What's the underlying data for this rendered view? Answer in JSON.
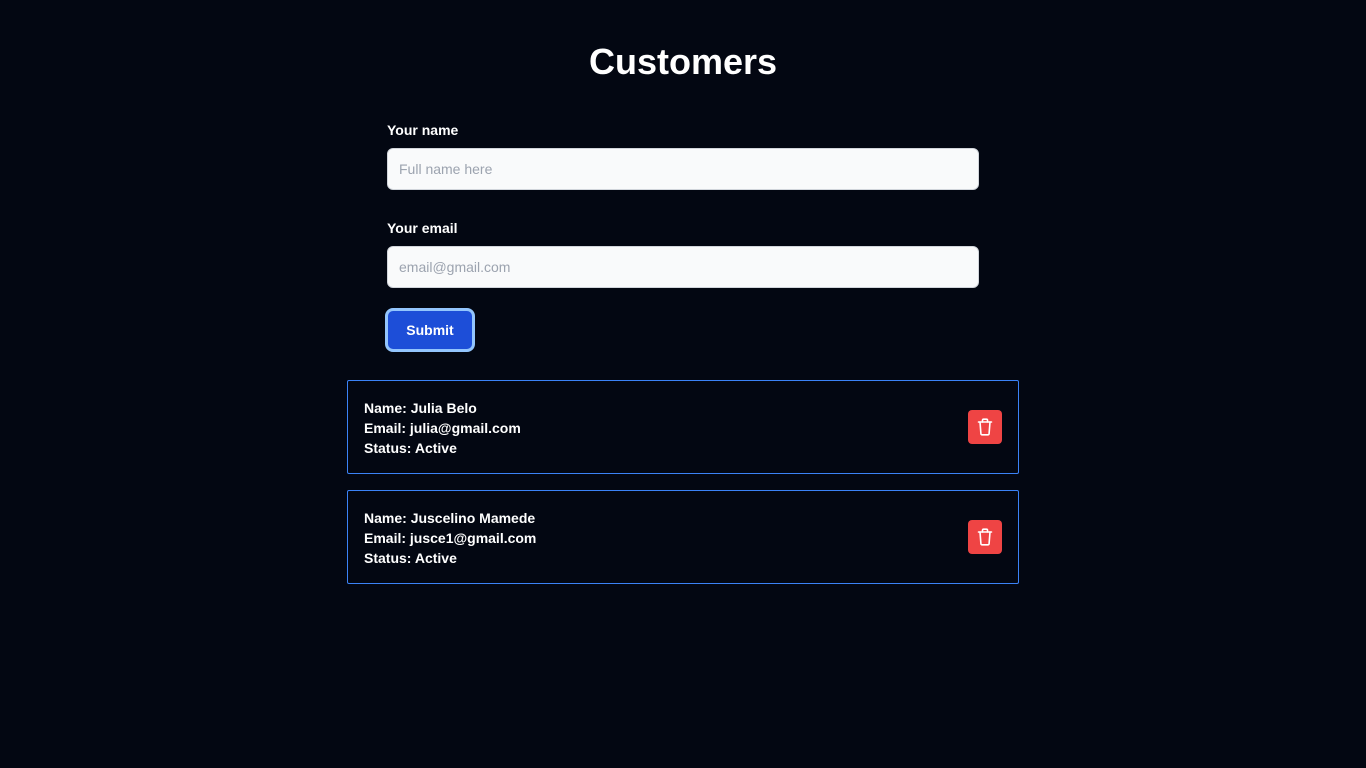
{
  "page": {
    "title": "Customers"
  },
  "form": {
    "name_label": "Your name",
    "name_placeholder": "Full name here",
    "name_value": "",
    "email_label": "Your email",
    "email_placeholder": "email@gmail.com",
    "email_value": "",
    "submit_label": "Submit"
  },
  "customers": [
    {
      "name": "Julia Belo",
      "email": "julia@gmail.com",
      "status": "Active",
      "delete_icon": "trash-icon"
    },
    {
      "name": "Juscelino Mamede",
      "email": "jusce1@gmail.com",
      "status": "Active",
      "delete_icon": "trash-icon"
    }
  ],
  "labels": {
    "name_prefix": "Name:",
    "email_prefix": "Email:",
    "status_prefix": "Status:"
  },
  "colors": {
    "background": "#030712",
    "accent": "#1d4ed8",
    "card_border": "#3b82f6",
    "danger": "#ef4444"
  }
}
